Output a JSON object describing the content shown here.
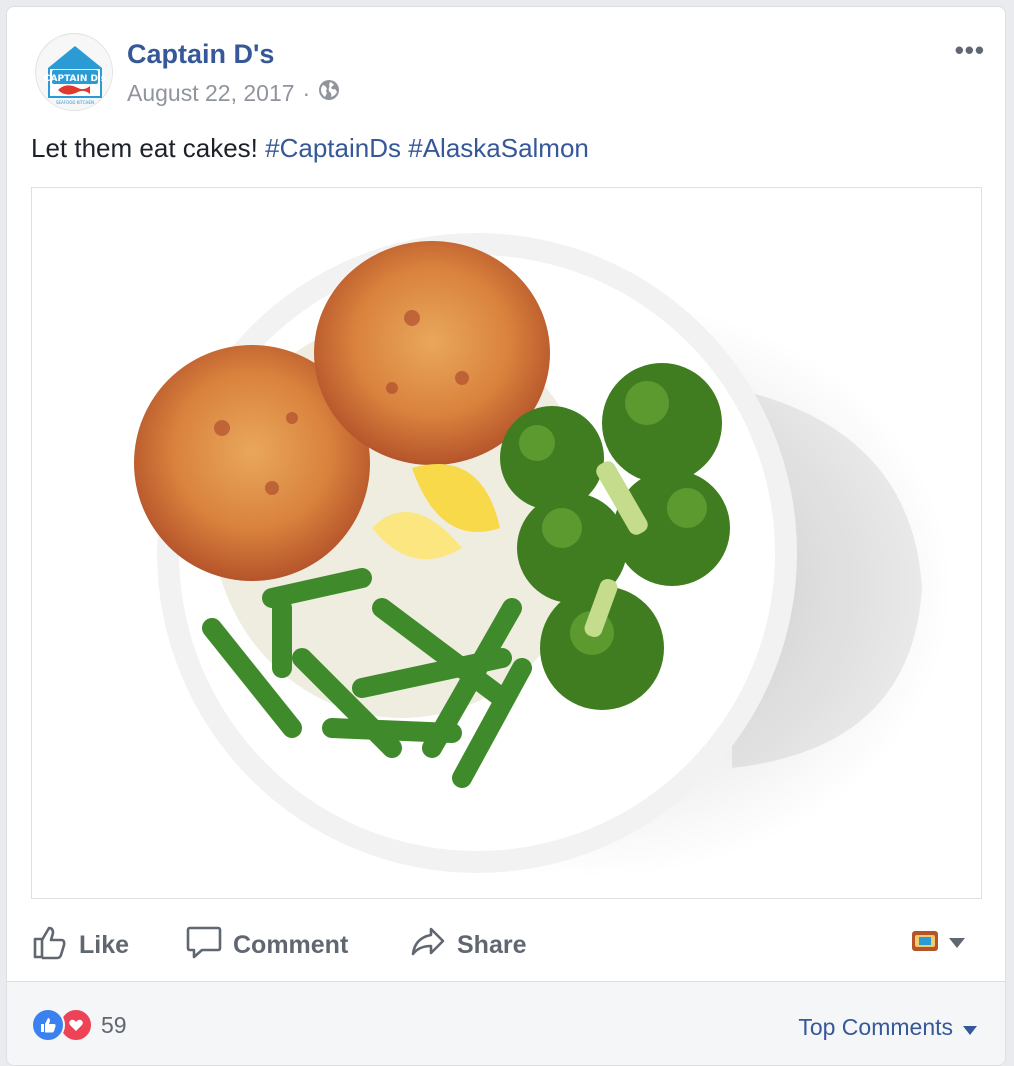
{
  "post": {
    "author": "Captain D's",
    "date": "August 22, 2017",
    "separator": "·",
    "text": "Let them eat cakes!",
    "hashtags": [
      "#CaptainDs",
      "#AlaskaSalmon"
    ]
  },
  "avatar": {
    "logo_text": "CAPTAIN D's",
    "logo_subtext": "SEAFOOD KITCHEN",
    "brand_color": "#e03a2f",
    "accent_color": "#2b9bd6"
  },
  "actions": {
    "like": "Like",
    "comment": "Comment",
    "share": "Share"
  },
  "footer": {
    "reaction_count": "59",
    "sort_label": "Top Comments"
  },
  "colors": {
    "link": "#365899",
    "muted": "#606770",
    "background": "#e9ebee"
  },
  "icons": [
    "globe-icon",
    "more-icon",
    "like-icon",
    "comment-icon",
    "share-icon",
    "audience-icon",
    "caret-down-icon"
  ]
}
